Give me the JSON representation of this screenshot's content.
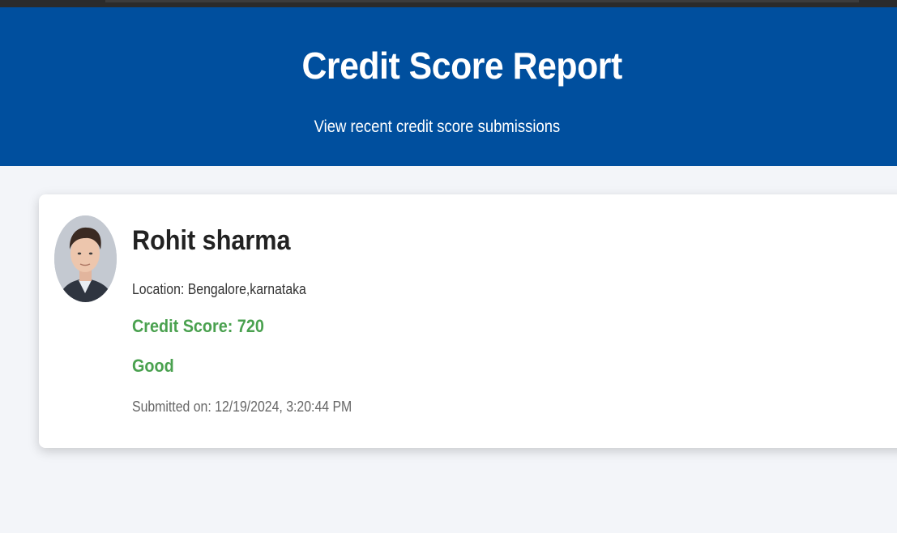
{
  "header": {
    "title": "Credit Score Report",
    "subtitle": "View recent credit score submissions"
  },
  "submission": {
    "avatar_icon": "person-photo",
    "name": "Rohit sharma",
    "location": "Location: Bengalore,karnataka",
    "credit_score": "Credit Score: 720",
    "rating": "Good",
    "submitted": "Submitted on: 12/19/2024, 3:20:44 PM"
  },
  "colors": {
    "header_bg": "#004f9e",
    "page_bg": "#f3f5f9",
    "score_green": "#4aa14f"
  }
}
